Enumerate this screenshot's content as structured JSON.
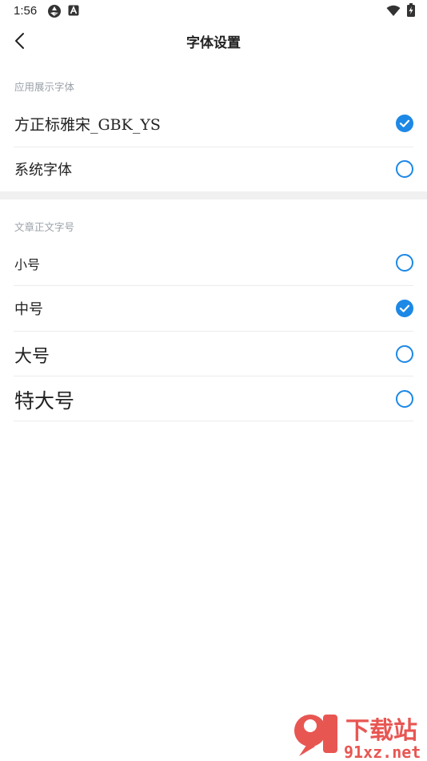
{
  "status_bar": {
    "time": "1:56",
    "icons": [
      "game-controller-icon",
      "font-a-icon",
      "wifi-icon",
      "battery-charging-icon"
    ]
  },
  "header": {
    "title": "字体设置",
    "back_icon": "chevron-left-icon"
  },
  "display_font_section": {
    "label": "应用展示字体",
    "options": [
      {
        "label": "方正标雅宋_GBK_YS",
        "selected": true
      },
      {
        "label": "系统字体",
        "selected": false
      }
    ]
  },
  "article_size_section": {
    "label": "文章正文字号",
    "options": [
      {
        "label": "小号",
        "selected": false
      },
      {
        "label": "中号",
        "selected": true
      },
      {
        "label": "大号",
        "selected": false
      },
      {
        "label": "特大号",
        "selected": false
      }
    ]
  },
  "watermark": {
    "brand": "下载站",
    "site": "91xz.net"
  },
  "colors": {
    "accent": "#1d88e6",
    "section_label": "#9aa0a8",
    "divider": "#ececec",
    "band": "#f0f0f0",
    "watermark": "#e53935"
  }
}
